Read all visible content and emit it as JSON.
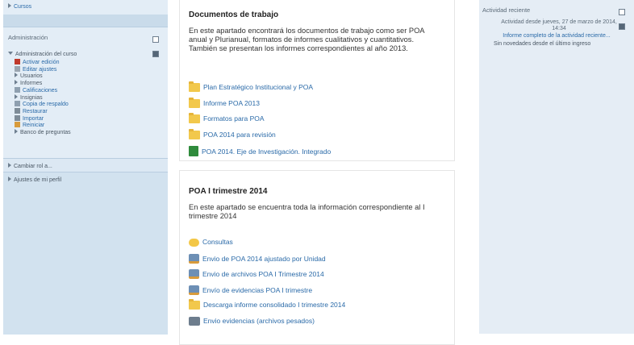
{
  "left": {
    "cursos": "Cursos",
    "administracion": {
      "title": "Administración",
      "curso": "Administración del curso",
      "items": [
        {
          "label": "Activar edición",
          "link": true
        },
        {
          "label": "Editar ajustes",
          "link": true
        },
        {
          "label": "Usuarios",
          "link": false
        },
        {
          "label": "Informes",
          "link": false
        },
        {
          "label": "Calificaciones",
          "link": true
        },
        {
          "label": "Insignias",
          "link": false
        },
        {
          "label": "Copia de respaldo",
          "link": true
        },
        {
          "label": "Restaurar",
          "link": true
        },
        {
          "label": "Importar",
          "link": true
        },
        {
          "label": "Reiniciar",
          "link": true
        },
        {
          "label": "Banco de preguntas",
          "link": false
        }
      ]
    },
    "cambiar_rol": "Cambiar rol a...",
    "ajustes_perfil": "Ajustes de mi perfil"
  },
  "main": {
    "section1": {
      "title": "Documentos de trabajo",
      "text": "En este apartado encontrará los documentos de trabajo como ser POA anual y Plurianual, formatos de informes cualitativos y cuantitativos.   También se presentan los informes correspondientes al año 2013.",
      "resources": [
        {
          "label": "Plan Estratégico Institucional y POA",
          "icon": "folder-icon"
        },
        {
          "label": "Informe POA 2013",
          "icon": "folder-icon"
        },
        {
          "label": "Formatos para POA",
          "icon": "folder-icon"
        },
        {
          "label": "POA 2014 para revisión",
          "icon": "folder-icon"
        },
        {
          "label": "POA 2014. Eje de Investigación. Integrado",
          "icon": "spreadsheet-icon"
        }
      ]
    },
    "section2": {
      "title": "POA I trimestre 2014",
      "text": "En este apartado se encuentra toda la información correspondiente al I trimestre 2014",
      "resources": [
        {
          "label": "Consultas",
          "icon": "forum-icon"
        },
        {
          "label": "Envio de POA 2014 ajustado por Unidad",
          "icon": "assignment-icon"
        },
        {
          "label": "Envio de archivos POA I Trimestre 2014",
          "icon": "assignment-icon"
        },
        {
          "label": "Envío de evidencias POA I trimestre",
          "icon": "assignment-icon"
        },
        {
          "label": "Descarga informe consolidado I trimestre 2014",
          "icon": "folder-icon"
        },
        {
          "label": "Envio evidencias (archivos pesados)",
          "icon": "upload-icon"
        }
      ]
    }
  },
  "right": {
    "title": "Actividad reciente",
    "since": "Actividad desde jueves, 27 de marzo de 2014, 14:34",
    "report_link": "Informe completo de la actividad reciente...",
    "none": "Sin novedades desde el último ingreso"
  }
}
